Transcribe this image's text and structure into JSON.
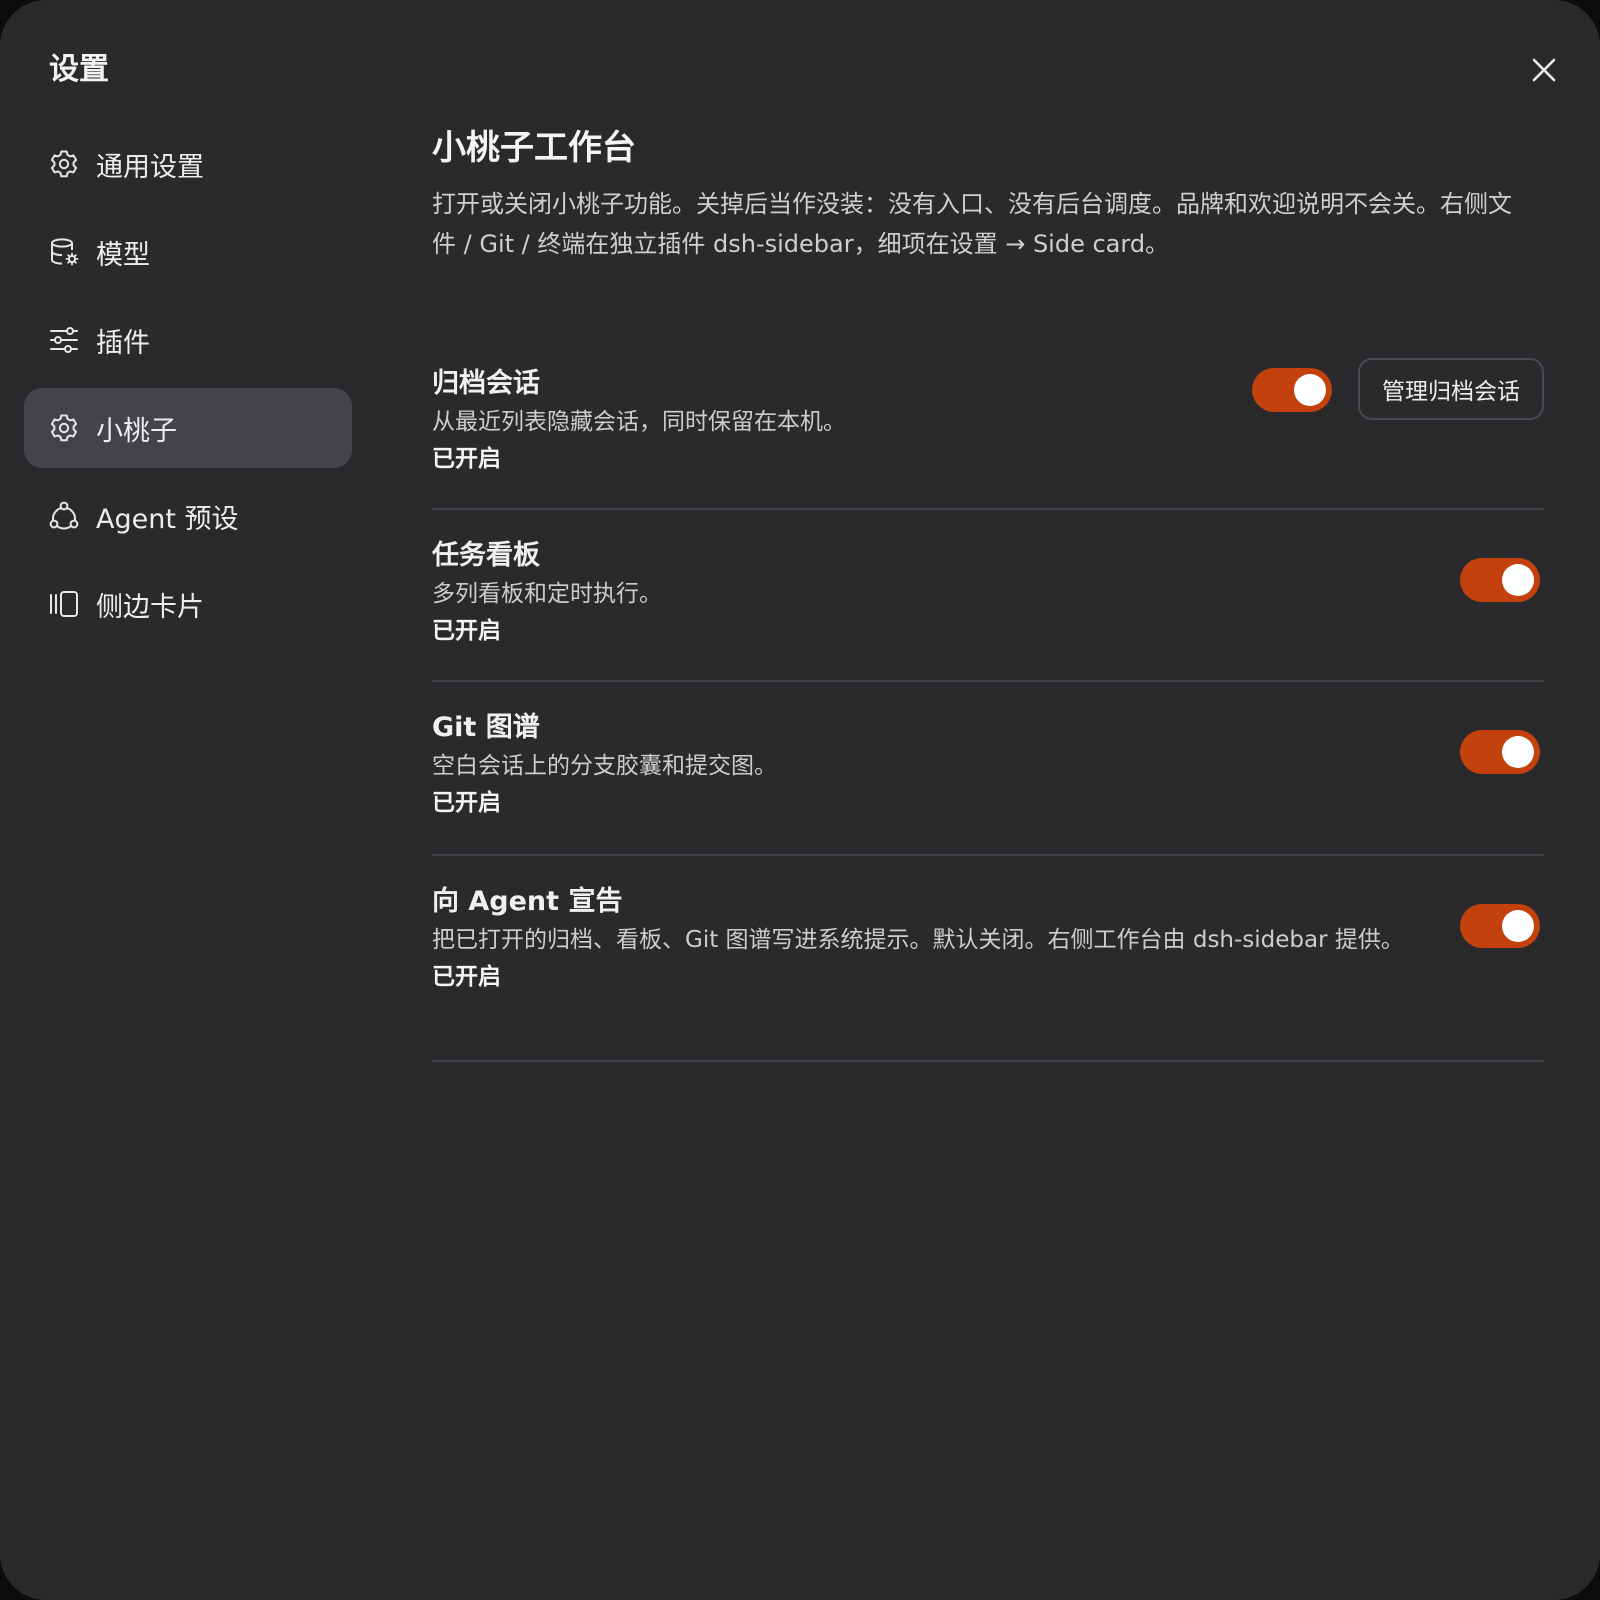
{
  "dialog": {
    "title": "设置",
    "close_icon": "close-icon"
  },
  "sidebar": {
    "items": [
      {
        "label": "通用设置",
        "icon": "gear-icon",
        "active": false
      },
      {
        "label": "模型",
        "icon": "database-gear-icon",
        "active": false
      },
      {
        "label": "插件",
        "icon": "sliders-icon",
        "active": false
      },
      {
        "label": "小桃子",
        "icon": "gear-icon",
        "active": true
      },
      {
        "label": "Agent 预设",
        "icon": "agent-network-icon",
        "active": false
      },
      {
        "label": "侧边卡片",
        "icon": "side-cards-icon",
        "active": false
      }
    ]
  },
  "main": {
    "title": "小桃子工作台",
    "description": "打开或关闭小桃子功能。关掉后当作没装：没有入口、没有后台调度。品牌和欢迎说明不会关。右侧文件 / Git / 终端在独立插件 dsh-sidebar，细项在设置 → Side card。",
    "rows": [
      {
        "title": "归档会话",
        "desc": "从最近列表隐藏会话，同时保留在本机。",
        "status": "已开启",
        "enabled": true,
        "button_label": "管理归档会话"
      },
      {
        "title": "任务看板",
        "desc": "多列看板和定时执行。",
        "status": "已开启",
        "enabled": true
      },
      {
        "title": "Git 图谱",
        "desc": "空白会话上的分支胶囊和提交图。",
        "status": "已开启",
        "enabled": true
      },
      {
        "title": "向 Agent 宣告",
        "desc": "把已打开的归档、看板、Git 图谱写进系统提示。默认关闭。右侧工作台由 dsh-sidebar 提供。",
        "status": "已开启",
        "enabled": true
      }
    ]
  },
  "colors": {
    "background": "#2a2a2d",
    "active_nav": "#43444a",
    "toggle_on": "#c2410c",
    "divider": "#414146"
  }
}
